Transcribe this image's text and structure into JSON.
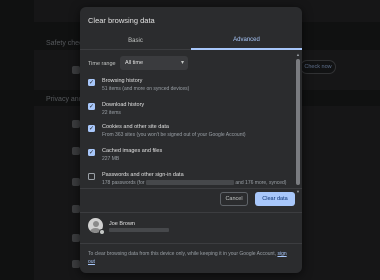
{
  "background": {
    "labels": [
      "Safety chec",
      "Privacy and"
    ],
    "button_label": "Check now"
  },
  "dialog": {
    "title": "Clear browsing data",
    "tabs": [
      {
        "label": "Basic",
        "active": false
      },
      {
        "label": "Advanced",
        "active": true
      }
    ],
    "time_range": {
      "label": "Time range",
      "value": "All time"
    },
    "items": [
      {
        "title": "Browsing history",
        "subtitle": "51 items (and more on synced devices)",
        "checked": true
      },
      {
        "title": "Download history",
        "subtitle": "22 items",
        "checked": true
      },
      {
        "title": "Cookies and other site data",
        "subtitle": "From 363 sites (you won't be signed out of your Google Account)",
        "checked": true
      },
      {
        "title": "Cached images and files",
        "subtitle": "227 MB",
        "checked": true
      },
      {
        "title": "Passwords and other sign-in data",
        "subtitle_start": "178 passwords (for",
        "subtitle_end": "and 176 more, synced)",
        "checked": false
      }
    ],
    "buttons": {
      "cancel": "Cancel",
      "clear": "Clear data"
    },
    "account": {
      "name": "Joe Brown"
    },
    "footer": {
      "text": "To clear browsing data from this device only, while keeping it in your Google Account,",
      "link": "sign out"
    }
  },
  "colors": {
    "accent": "#a8c7fa",
    "dialog_bg": "#2b2c2e",
    "page_bg": "#1e1f20"
  }
}
